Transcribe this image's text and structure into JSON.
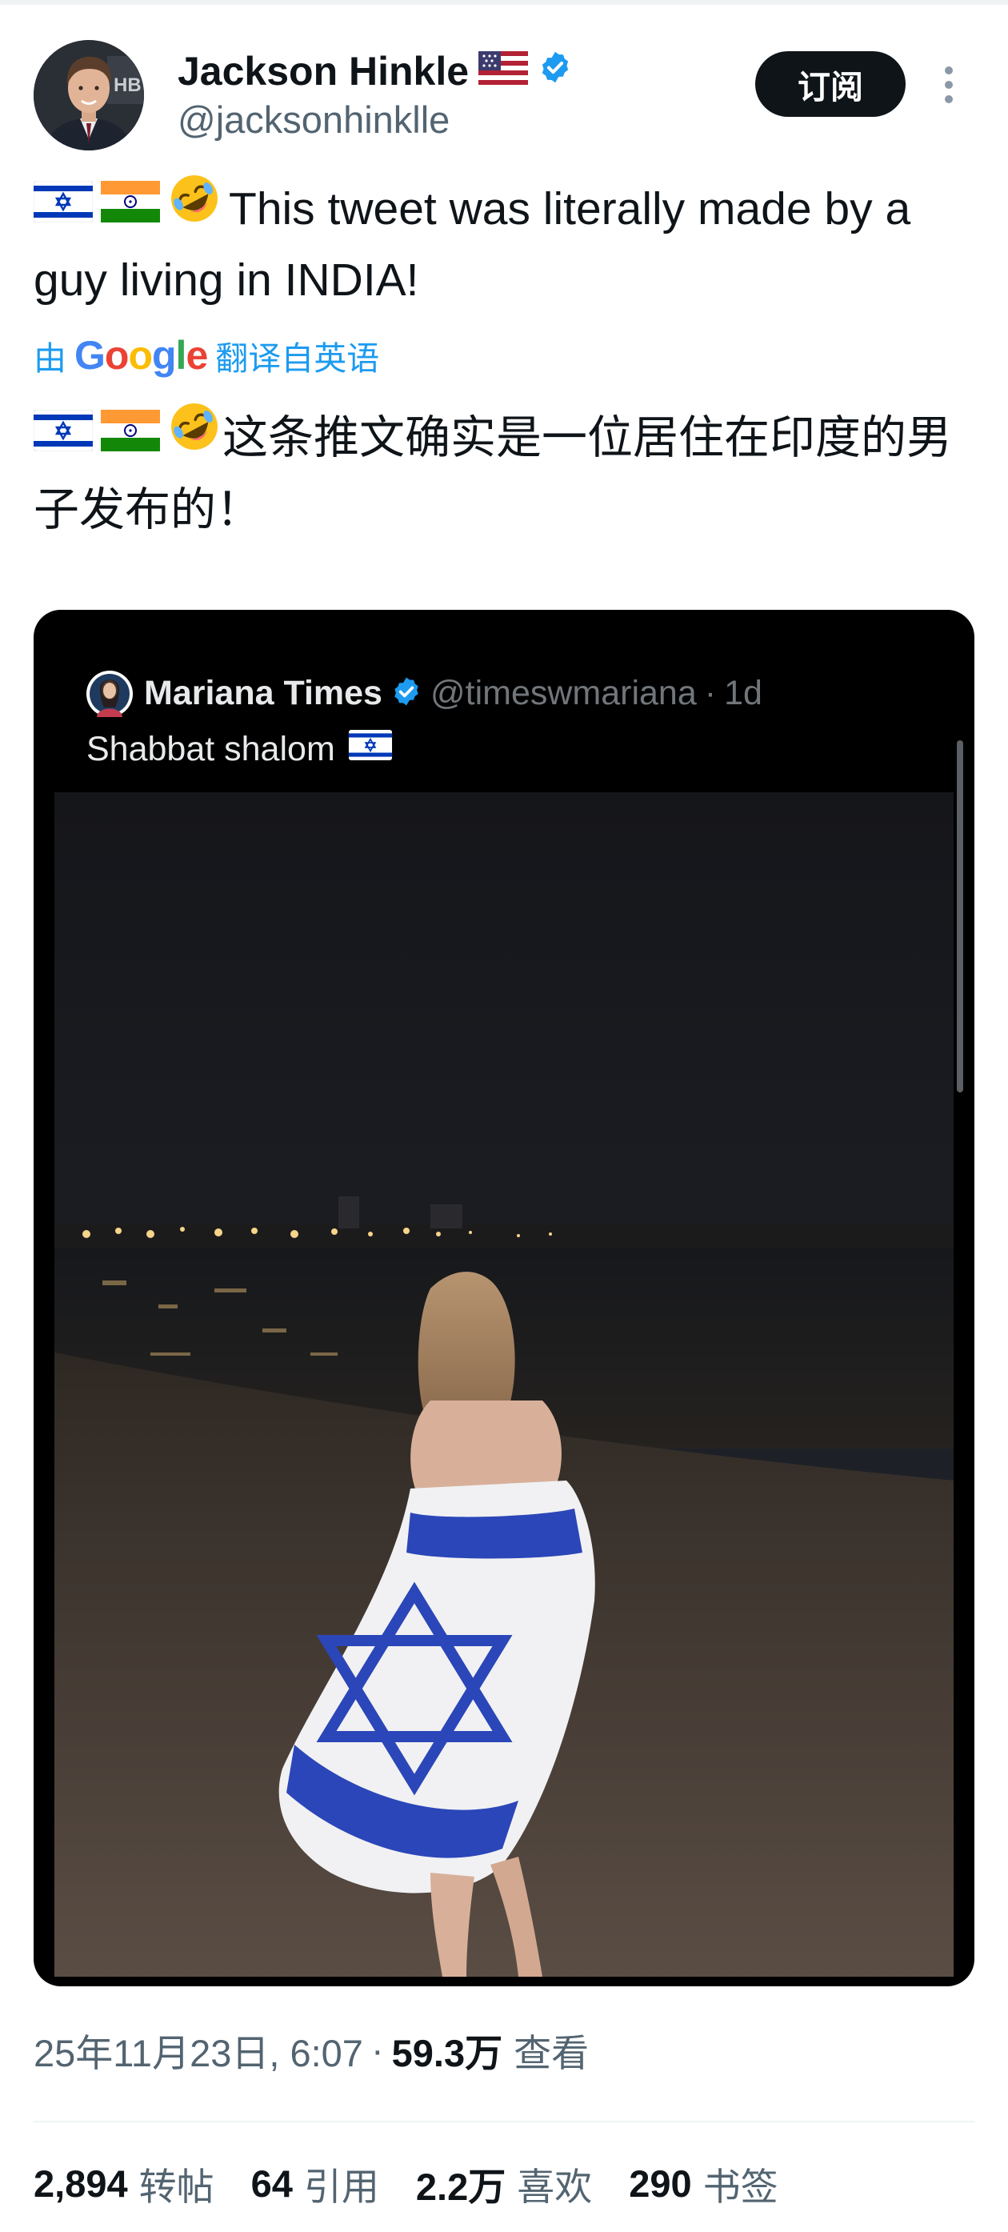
{
  "author": {
    "name": "Jackson Hinkle",
    "handle": "@jacksonhinklle",
    "flag_icon": "us-flag-icon",
    "verified_icon": "verified-badge-icon",
    "verified_color": "#1d9bf0"
  },
  "header": {
    "subscribe_label": "订阅",
    "more_icon": "more-vertical-icon"
  },
  "tweet": {
    "emojis": [
      "israel-flag-icon",
      "india-flag-icon",
      "rolling-on-floor-laughing-icon"
    ],
    "text": "This tweet was literally made by a guy living in INDIA!",
    "translation_prefix": "由",
    "translation_brand": "Google",
    "translation_suffix": "翻译自英语",
    "translated_text": "这条推文确实是一位居住在印度的男子发布的！"
  },
  "quote": {
    "name": "Mariana Times",
    "handle": "@timeswmariana",
    "separator": "·",
    "time": "1d",
    "text": "Shabbat shalom",
    "image": "night-beach-woman-with-israel-flag"
  },
  "meta": {
    "datetime": "25年11月23日, 6:07",
    "separator": "·",
    "views_count": "59.3万",
    "views_label": "查看"
  },
  "stats": [
    {
      "count": "2,894",
      "label": "转帖"
    },
    {
      "count": "64",
      "label": "引用"
    },
    {
      "count": "2.2万",
      "label": "喜欢"
    },
    {
      "count": "290",
      "label": "书签"
    }
  ],
  "colors": {
    "text": "#0f1419",
    "secondary": "#536471",
    "link": "#1d9bf0",
    "button_bg": "#0f1419",
    "card_bg": "#000000",
    "israel_blue": "#0038b8"
  }
}
